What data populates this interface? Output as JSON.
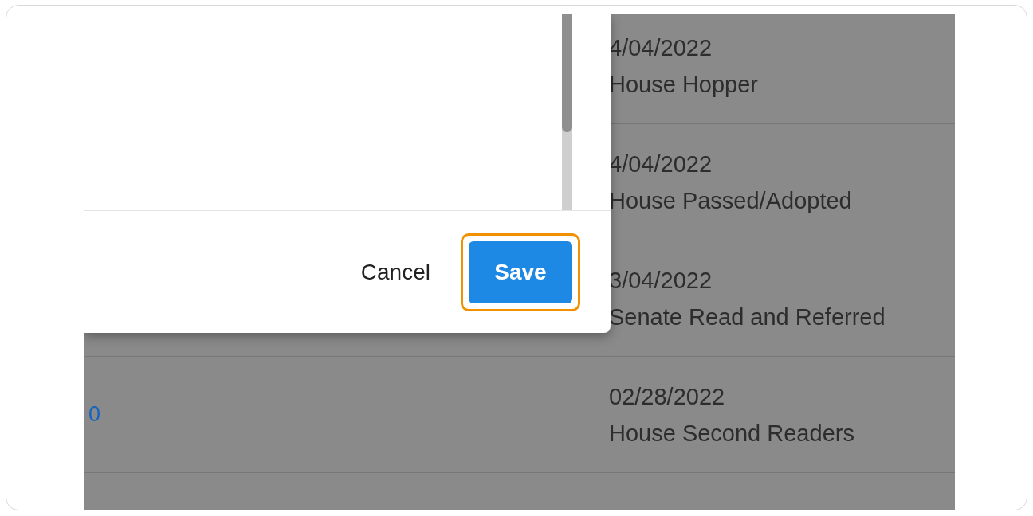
{
  "rows": [
    {
      "date": "4/04/2022",
      "status": "House Hopper"
    },
    {
      "date": "4/04/2022",
      "status": "House Passed/Adopted"
    },
    {
      "date": "3/04/2022",
      "status": "Senate Read and Referred"
    },
    {
      "link": "0",
      "date": "02/28/2022",
      "status": "House Second Readers"
    },
    {}
  ],
  "dialog": {
    "buttons": [
      {
        "label": "Cancel",
        "kind": "text",
        "focused": false
      },
      {
        "label": "Save",
        "kind": "primary",
        "focused": true
      }
    ]
  }
}
